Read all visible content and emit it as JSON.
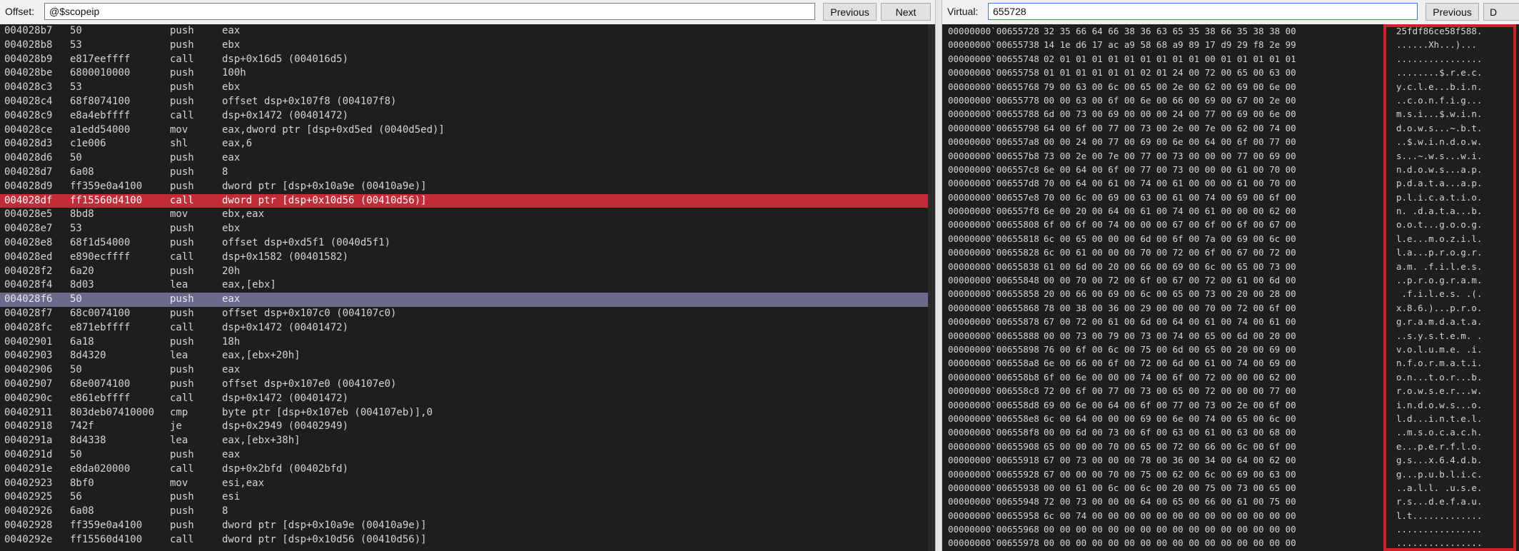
{
  "disasm": {
    "offset_label": "Offset:",
    "offset_value": "@$scopeip",
    "previous_label": "Previous",
    "next_label": "Next",
    "lines": [
      {
        "addr": "004028b7",
        "bytes": "50",
        "mn": "push",
        "op": "eax",
        "state": ""
      },
      {
        "addr": "004028b8",
        "bytes": "53",
        "mn": "push",
        "op": "ebx",
        "state": ""
      },
      {
        "addr": "004028b9",
        "bytes": "e817eeffff",
        "mn": "call",
        "op": "dsp+0x16d5 (004016d5)",
        "state": ""
      },
      {
        "addr": "004028be",
        "bytes": "6800010000",
        "mn": "push",
        "op": "100h",
        "state": ""
      },
      {
        "addr": "004028c3",
        "bytes": "53",
        "mn": "push",
        "op": "ebx",
        "state": ""
      },
      {
        "addr": "004028c4",
        "bytes": "68f8074100",
        "mn": "push",
        "op": "offset dsp+0x107f8 (004107f8)",
        "state": ""
      },
      {
        "addr": "004028c9",
        "bytes": "e8a4ebffff",
        "mn": "call",
        "op": "dsp+0x1472 (00401472)",
        "state": ""
      },
      {
        "addr": "004028ce",
        "bytes": "a1edd54000",
        "mn": "mov",
        "op": "eax,dword ptr [dsp+0xd5ed (0040d5ed)]",
        "state": ""
      },
      {
        "addr": "004028d3",
        "bytes": "c1e006",
        "mn": "shl",
        "op": "eax,6",
        "state": ""
      },
      {
        "addr": "004028d6",
        "bytes": "50",
        "mn": "push",
        "op": "eax",
        "state": ""
      },
      {
        "addr": "004028d7",
        "bytes": "6a08",
        "mn": "push",
        "op": "8",
        "state": ""
      },
      {
        "addr": "004028d9",
        "bytes": "ff359e0a4100",
        "mn": "push",
        "op": "dword ptr [dsp+0x10a9e (00410a9e)]",
        "state": ""
      },
      {
        "addr": "004028df",
        "bytes": "ff15560d4100",
        "mn": "call",
        "op": "dword ptr [dsp+0x10d56 (00410d56)]",
        "state": "bp"
      },
      {
        "addr": "004028e5",
        "bytes": "8bd8",
        "mn": "mov",
        "op": "ebx,eax",
        "state": ""
      },
      {
        "addr": "004028e7",
        "bytes": "53",
        "mn": "push",
        "op": "ebx",
        "state": ""
      },
      {
        "addr": "004028e8",
        "bytes": "68f1d54000",
        "mn": "push",
        "op": "offset dsp+0xd5f1 (0040d5f1)",
        "state": ""
      },
      {
        "addr": "004028ed",
        "bytes": "e890ecffff",
        "mn": "call",
        "op": "dsp+0x1582 (00401582)",
        "state": ""
      },
      {
        "addr": "004028f2",
        "bytes": "6a20",
        "mn": "push",
        "op": "20h",
        "state": ""
      },
      {
        "addr": "004028f4",
        "bytes": "8d03",
        "mn": "lea",
        "op": "eax,[ebx]",
        "state": ""
      },
      {
        "addr": "004028f6",
        "bytes": "50",
        "mn": "push",
        "op": "eax",
        "state": "cur"
      },
      {
        "addr": "004028f7",
        "bytes": "68c0074100",
        "mn": "push",
        "op": "offset dsp+0x107c0 (004107c0)",
        "state": ""
      },
      {
        "addr": "004028fc",
        "bytes": "e871ebffff",
        "mn": "call",
        "op": "dsp+0x1472 (00401472)",
        "state": ""
      },
      {
        "addr": "00402901",
        "bytes": "6a18",
        "mn": "push",
        "op": "18h",
        "state": ""
      },
      {
        "addr": "00402903",
        "bytes": "8d4320",
        "mn": "lea",
        "op": "eax,[ebx+20h]",
        "state": ""
      },
      {
        "addr": "00402906",
        "bytes": "50",
        "mn": "push",
        "op": "eax",
        "state": ""
      },
      {
        "addr": "00402907",
        "bytes": "68e0074100",
        "mn": "push",
        "op": "offset dsp+0x107e0 (004107e0)",
        "state": ""
      },
      {
        "addr": "0040290c",
        "bytes": "e861ebffff",
        "mn": "call",
        "op": "dsp+0x1472 (00401472)",
        "state": ""
      },
      {
        "addr": "00402911",
        "bytes": "803deb07410000",
        "mn": "cmp",
        "op": "byte ptr [dsp+0x107eb (004107eb)],0",
        "state": ""
      },
      {
        "addr": "00402918",
        "bytes": "742f",
        "mn": "je",
        "op": "dsp+0x2949 (00402949)",
        "state": ""
      },
      {
        "addr": "0040291a",
        "bytes": "8d4338",
        "mn": "lea",
        "op": "eax,[ebx+38h]",
        "state": ""
      },
      {
        "addr": "0040291d",
        "bytes": "50",
        "mn": "push",
        "op": "eax",
        "state": ""
      },
      {
        "addr": "0040291e",
        "bytes": "e8da020000",
        "mn": "call",
        "op": "dsp+0x2bfd (00402bfd)",
        "state": ""
      },
      {
        "addr": "00402923",
        "bytes": "8bf0",
        "mn": "mov",
        "op": "esi,eax",
        "state": ""
      },
      {
        "addr": "00402925",
        "bytes": "56",
        "mn": "push",
        "op": "esi",
        "state": ""
      },
      {
        "addr": "00402926",
        "bytes": "6a08",
        "mn": "push",
        "op": "8",
        "state": ""
      },
      {
        "addr": "00402928",
        "bytes": "ff359e0a4100",
        "mn": "push",
        "op": "dword ptr [dsp+0x10a9e (00410a9e)]",
        "state": ""
      },
      {
        "addr": "0040292e",
        "bytes": "ff15560d4100",
        "mn": "call",
        "op": "dword ptr [dsp+0x10d56 (00410d56)]",
        "state": ""
      }
    ]
  },
  "memory": {
    "virtual_label": "Virtual:",
    "virtual_value": "655728",
    "previous_label": "Previous",
    "cut_label": "D",
    "lines": [
      {
        "addr": "00000000`00655728",
        "bytes": "32 35 66 64 66 38 36 63 65 35 38 66 35 38 38 00",
        "ascii": "25fdf86ce58f588."
      },
      {
        "addr": "00000000`00655738",
        "bytes": "14 1e d6 17 ac a9 58 68 a9 89 17 d9 29 f8 2e 99",
        "ascii": "......Xh...)..."
      },
      {
        "addr": "00000000`00655748",
        "bytes": "02 01 01 01 01 01 01 01 01 01 00 01 01 01 01 01",
        "ascii": "................"
      },
      {
        "addr": "00000000`00655758",
        "bytes": "01 01 01 01 01 01 02 01 24 00 72 00 65 00 63 00",
        "ascii": "........$.r.e.c."
      },
      {
        "addr": "00000000`00655768",
        "bytes": "79 00 63 00 6c 00 65 00 2e 00 62 00 69 00 6e 00",
        "ascii": "y.c.l.e...b.i.n."
      },
      {
        "addr": "00000000`00655778",
        "bytes": "00 00 63 00 6f 00 6e 00 66 00 69 00 67 00 2e 00",
        "ascii": "..c.o.n.f.i.g..."
      },
      {
        "addr": "00000000`00655788",
        "bytes": "6d 00 73 00 69 00 00 00 24 00 77 00 69 00 6e 00",
        "ascii": "m.s.i...$.w.i.n."
      },
      {
        "addr": "00000000`00655798",
        "bytes": "64 00 6f 00 77 00 73 00 2e 00 7e 00 62 00 74 00",
        "ascii": "d.o.w.s...~.b.t."
      },
      {
        "addr": "00000000`006557a8",
        "bytes": "00 00 24 00 77 00 69 00 6e 00 64 00 6f 00 77 00",
        "ascii": "..$.w.i.n.d.o.w."
      },
      {
        "addr": "00000000`006557b8",
        "bytes": "73 00 2e 00 7e 00 77 00 73 00 00 00 77 00 69 00",
        "ascii": "s...~.w.s...w.i."
      },
      {
        "addr": "00000000`006557c8",
        "bytes": "6e 00 64 00 6f 00 77 00 73 00 00 00 61 00 70 00",
        "ascii": "n.d.o.w.s...a.p."
      },
      {
        "addr": "00000000`006557d8",
        "bytes": "70 00 64 00 61 00 74 00 61 00 00 00 61 00 70 00",
        "ascii": "p.d.a.t.a...a.p."
      },
      {
        "addr": "00000000`006557e8",
        "bytes": "70 00 6c 00 69 00 63 00 61 00 74 00 69 00 6f 00",
        "ascii": "p.l.i.c.a.t.i.o."
      },
      {
        "addr": "00000000`006557f8",
        "bytes": "6e 00 20 00 64 00 61 00 74 00 61 00 00 00 62 00",
        "ascii": "n. .d.a.t.a...b."
      },
      {
        "addr": "00000000`00655808",
        "bytes": "6f 00 6f 00 74 00 00 00 67 00 6f 00 6f 00 67 00",
        "ascii": "o.o.t...g.o.o.g."
      },
      {
        "addr": "00000000`00655818",
        "bytes": "6c 00 65 00 00 00 6d 00 6f 00 7a 00 69 00 6c 00",
        "ascii": "l.e...m.o.z.i.l."
      },
      {
        "addr": "00000000`00655828",
        "bytes": "6c 00 61 00 00 00 70 00 72 00 6f 00 67 00 72 00",
        "ascii": "l.a...p.r.o.g.r."
      },
      {
        "addr": "00000000`00655838",
        "bytes": "61 00 6d 00 20 00 66 00 69 00 6c 00 65 00 73 00",
        "ascii": "a.m. .f.i.l.e.s."
      },
      {
        "addr": "00000000`00655848",
        "bytes": "00 00 70 00 72 00 6f 00 67 00 72 00 61 00 6d 00",
        "ascii": "..p.r.o.g.r.a.m."
      },
      {
        "addr": "00000000`00655858",
        "bytes": "20 00 66 00 69 00 6c 00 65 00 73 00 20 00 28 00",
        "ascii": " .f.i.l.e.s. .(."
      },
      {
        "addr": "00000000`00655868",
        "bytes": "78 00 38 00 36 00 29 00 00 00 70 00 72 00 6f 00",
        "ascii": "x.8.6.)...p.r.o."
      },
      {
        "addr": "00000000`00655878",
        "bytes": "67 00 72 00 61 00 6d 00 64 00 61 00 74 00 61 00",
        "ascii": "g.r.a.m.d.a.t.a."
      },
      {
        "addr": "00000000`00655888",
        "bytes": "00 00 73 00 79 00 73 00 74 00 65 00 6d 00 20 00",
        "ascii": "..s.y.s.t.e.m. ."
      },
      {
        "addr": "00000000`00655898",
        "bytes": "76 00 6f 00 6c 00 75 00 6d 00 65 00 20 00 69 00",
        "ascii": "v.o.l.u.m.e. .i."
      },
      {
        "addr": "00000000`006558a8",
        "bytes": "6e 00 66 00 6f 00 72 00 6d 00 61 00 74 00 69 00",
        "ascii": "n.f.o.r.m.a.t.i."
      },
      {
        "addr": "00000000`006558b8",
        "bytes": "6f 00 6e 00 00 00 74 00 6f 00 72 00 00 00 62 00",
        "ascii": "o.n...t.o.r...b."
      },
      {
        "addr": "00000000`006558c8",
        "bytes": "72 00 6f 00 77 00 73 00 65 00 72 00 00 00 77 00",
        "ascii": "r.o.w.s.e.r...w."
      },
      {
        "addr": "00000000`006558d8",
        "bytes": "69 00 6e 00 64 00 6f 00 77 00 73 00 2e 00 6f 00",
        "ascii": "i.n.d.o.w.s...o."
      },
      {
        "addr": "00000000`006558e8",
        "bytes": "6c 00 64 00 00 00 69 00 6e 00 74 00 65 00 6c 00",
        "ascii": "l.d...i.n.t.e.l."
      },
      {
        "addr": "00000000`006558f8",
        "bytes": "00 00 6d 00 73 00 6f 00 63 00 61 00 63 00 68 00",
        "ascii": "..m.s.o.c.a.c.h."
      },
      {
        "addr": "00000000`00655908",
        "bytes": "65 00 00 00 70 00 65 00 72 00 66 00 6c 00 6f 00",
        "ascii": "e...p.e.r.f.l.o."
      },
      {
        "addr": "00000000`00655918",
        "bytes": "67 00 73 00 00 00 78 00 36 00 34 00 64 00 62 00",
        "ascii": "g.s...x.6.4.d.b."
      },
      {
        "addr": "00000000`00655928",
        "bytes": "67 00 00 00 70 00 75 00 62 00 6c 00 69 00 63 00",
        "ascii": "g...p.u.b.l.i.c."
      },
      {
        "addr": "00000000`00655938",
        "bytes": "00 00 61 00 6c 00 6c 00 20 00 75 00 73 00 65 00",
        "ascii": "..a.l.l. .u.s.e."
      },
      {
        "addr": "00000000`00655948",
        "bytes": "72 00 73 00 00 00 64 00 65 00 66 00 61 00 75 00",
        "ascii": "r.s...d.e.f.a.u."
      },
      {
        "addr": "00000000`00655958",
        "bytes": "6c 00 74 00 00 00 00 00 00 00 00 00 00 00 00 00",
        "ascii": "l.t............."
      },
      {
        "addr": "00000000`00655968",
        "bytes": "00 00 00 00 00 00 00 00 00 00 00 00 00 00 00 00",
        "ascii": "................"
      },
      {
        "addr": "00000000`00655978",
        "bytes": "00 00 00 00 00 00 00 00 00 00 00 00 00 00 00 00",
        "ascii": "................"
      }
    ]
  },
  "colors": {
    "breakpoint_line": "#c42b36",
    "current_line": "#6b6a8a",
    "ascii_highlight_box": "#d0202a",
    "code_background": "#1e1e1e"
  }
}
